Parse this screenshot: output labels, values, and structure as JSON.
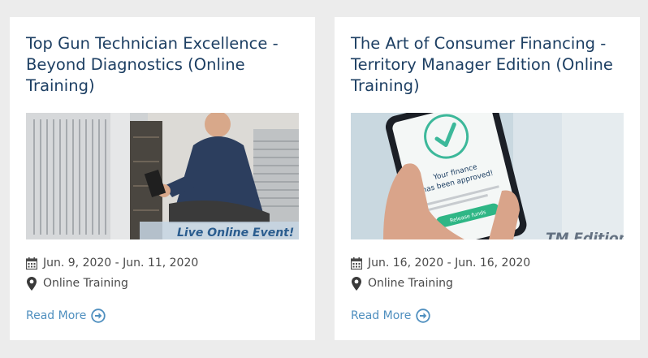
{
  "cards": [
    {
      "title": "Top Gun Technician Excellence - Beyond Diagnostics (Online Training)",
      "image_banner": "Live Online Event!",
      "date": "Jun. 9, 2020 - Jun. 11, 2020",
      "location": "Online Training",
      "read_more": "Read More"
    },
    {
      "title": "The Art of Consumer Financing - Territory Manager Edition (Online Training)",
      "image_phone_line1": "Your finance",
      "image_phone_line2": "has been approved!",
      "image_phone_button": "Release funds",
      "image_banner": "TM Edition",
      "date": "Jun. 16, 2020 - Jun. 16, 2020",
      "location": "Online Training",
      "read_more": "Read More"
    }
  ],
  "colors": {
    "page_bg": "#ececec",
    "card_bg": "#ffffff",
    "title": "#1d3f63",
    "meta_text": "#4a4a4a",
    "link": "#4f8fbf"
  }
}
